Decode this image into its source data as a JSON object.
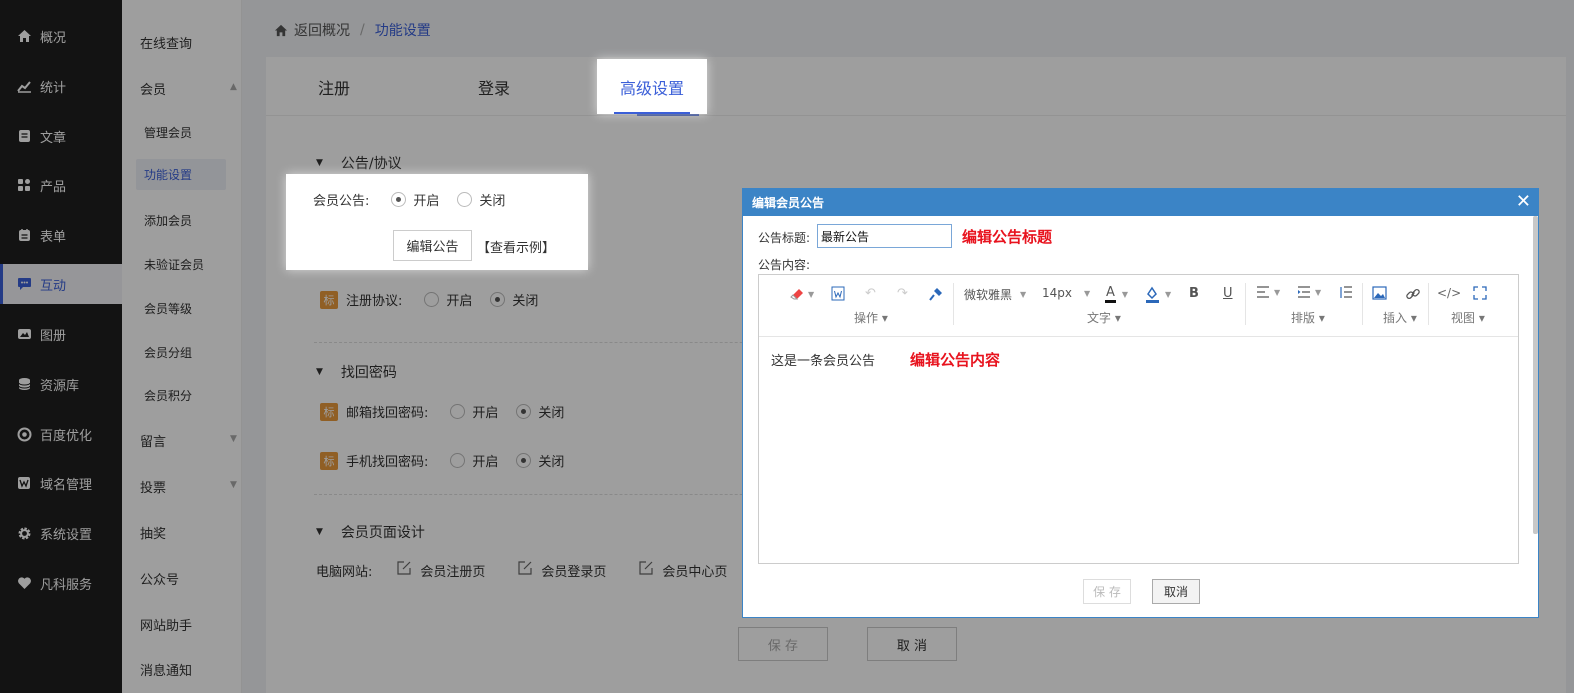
{
  "nav": {
    "items": [
      {
        "label": "概况",
        "icon": "home-icon"
      },
      {
        "label": "统计",
        "icon": "chart-icon"
      },
      {
        "label": "文章",
        "icon": "article-icon"
      },
      {
        "label": "产品",
        "icon": "grid-icon"
      },
      {
        "label": "表单",
        "icon": "form-icon"
      },
      {
        "label": "互动",
        "icon": "chat-icon"
      },
      {
        "label": "图册",
        "icon": "gallery-icon"
      },
      {
        "label": "资源库",
        "icon": "database-icon"
      },
      {
        "label": "百度优化",
        "icon": "seo-icon"
      },
      {
        "label": "域名管理",
        "icon": "domain-icon"
      },
      {
        "label": "系统设置",
        "icon": "gear-icon"
      },
      {
        "label": "凡科服务",
        "icon": "heart-icon"
      }
    ]
  },
  "subnav": {
    "items": [
      "在线查询",
      "会员",
      "管理会员",
      "功能设置",
      "添加会员",
      "未验证会员",
      "会员等级",
      "会员分组",
      "会员积分",
      "留言",
      "投票",
      "抽奖",
      "公众号",
      "网站助手",
      "消息通知"
    ]
  },
  "breadcrumb": {
    "back": "返回概况",
    "sep": "/",
    "current": "功能设置"
  },
  "tabs": {
    "register": "注册",
    "login": "登录",
    "advanced": "高级设置"
  },
  "sections": {
    "notice_title": "公告/协议",
    "notice_label": "会员公告:",
    "on": "开启",
    "off": "关闭",
    "edit_notice": "编辑公告",
    "view_example": "【查看示例】",
    "badge": "标",
    "reg_agreement": "注册协议:",
    "recover_title": "找回密码",
    "email_recover": "邮箱找回密码:",
    "phone_recover": "手机找回密码:",
    "design_title": "会员页面设计",
    "pc_site": "电脑网站:",
    "page_reg": "会员注册页",
    "page_login": "会员登录页",
    "page_center": "会员中心页",
    "save": "保 存",
    "cancel": "取 消"
  },
  "dialog": {
    "title": "编辑会员公告",
    "title_label": "公告标题:",
    "title_value": "最新公告",
    "title_note": "编辑公告标题",
    "content_label": "公告内容:",
    "font": "微软雅黑",
    "size": "14px",
    "groups": {
      "ops": "操作",
      "text": "文字",
      "layout": "排版",
      "insert": "插入",
      "view": "视图"
    },
    "content": "这是一条会员公告",
    "content_note": "编辑公告内容",
    "save": "保 存",
    "cancel": "取消"
  },
  "colors": {
    "accent": "#3b5fd8",
    "dialog_header": "#3b84c6",
    "note_red": "#e8131e",
    "badge": "#e89a3c"
  }
}
